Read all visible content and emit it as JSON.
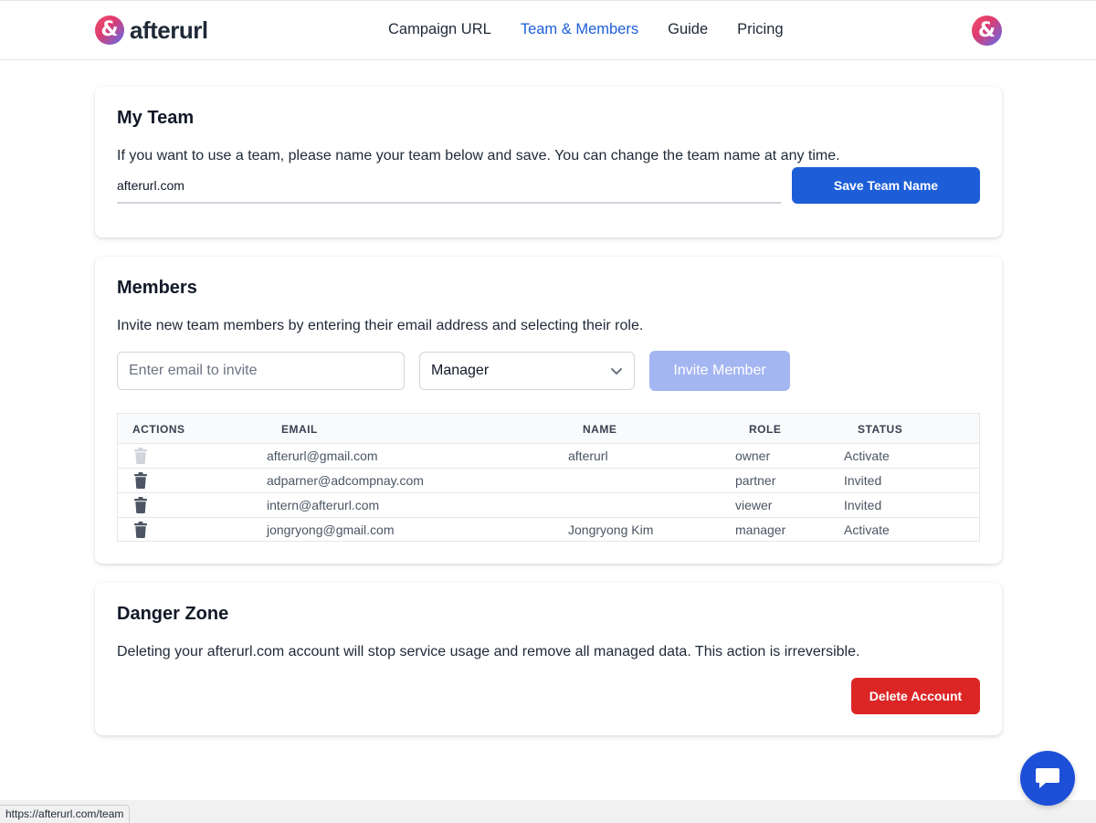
{
  "header": {
    "logo_mark": "&",
    "logo_text": "afterurl",
    "nav": [
      {
        "label": "Campaign URL"
      },
      {
        "label": "Team & Members"
      },
      {
        "label": "Guide"
      },
      {
        "label": "Pricing"
      }
    ],
    "active_nav": "Team & Members",
    "avatar_mark": "&"
  },
  "team": {
    "title": "My Team",
    "description": "If you want to use a team, please name your team below and save. You can change the team name at any time.",
    "team_name_value": "afterurl.com",
    "save_label": "Save Team Name"
  },
  "members": {
    "title": "Members",
    "description": "Invite new team members by entering their email address and selecting their role.",
    "email_placeholder": "Enter email to invite",
    "role_selected": "Manager",
    "invite_label": "Invite Member",
    "columns": [
      "ACTIONS",
      "EMAIL",
      "NAME",
      "ROLE",
      "STATUS"
    ],
    "rows": [
      {
        "email": "afterurl@gmail.com",
        "name": "afterurl",
        "role": "owner",
        "status": "Activate",
        "deletable": false
      },
      {
        "email": "adparner@adcompnay.com",
        "name": "",
        "role": "partner",
        "status": "Invited",
        "deletable": true
      },
      {
        "email": "intern@afterurl.com",
        "name": "",
        "role": "viewer",
        "status": "Invited",
        "deletable": true
      },
      {
        "email": "jongryong@gmail.com",
        "name": "Jongryong Kim",
        "role": "manager",
        "status": "Activate",
        "deletable": true
      }
    ]
  },
  "danger": {
    "title": "Danger Zone",
    "description": "Deleting your afterurl.com account will stop service usage and remove all managed data. This action is irreversible.",
    "delete_label": "Delete Account"
  },
  "status_bar": {
    "url": "https://afterurl.com/team"
  },
  "colors": {
    "brand_blue": "#1d5ed8",
    "invite_disabled": "#a4b6f1",
    "danger_red": "#dc2626",
    "trash_active": "#4b5563",
    "trash_disabled": "#d1d5db"
  },
  "icons": [
    "logo-ampersand-icon",
    "avatar-ampersand-icon",
    "chevron-down-icon",
    "trash-icon",
    "chat-bubble-icon"
  ]
}
